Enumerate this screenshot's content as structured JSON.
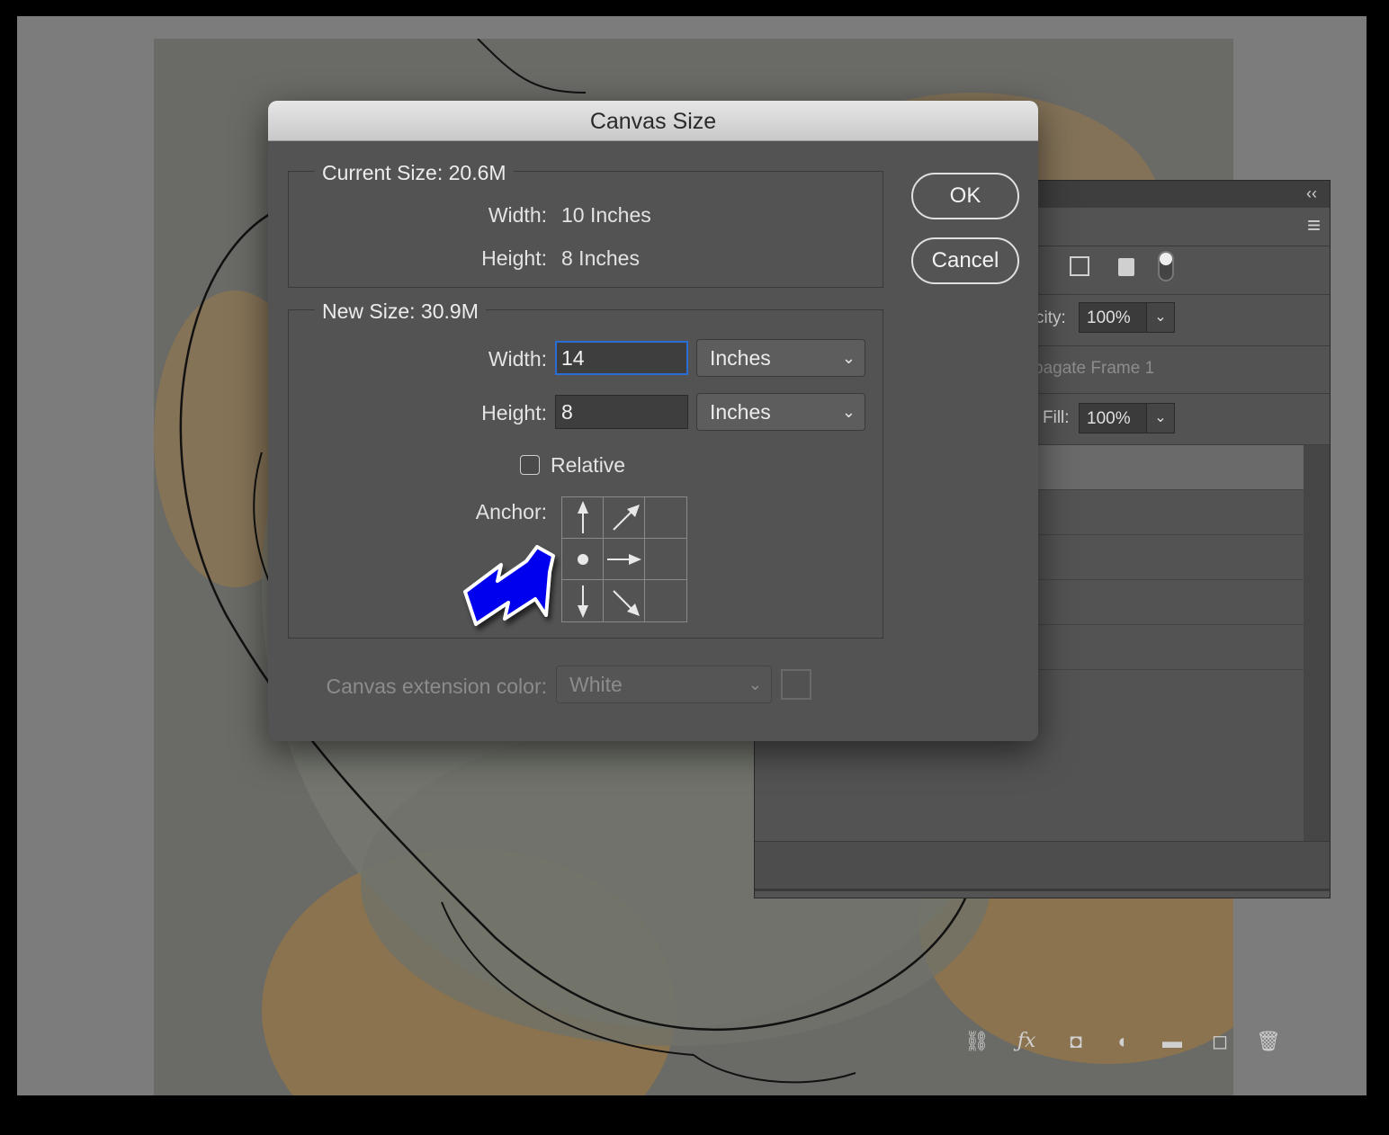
{
  "dialog": {
    "title": "Canvas Size",
    "current_size": {
      "legend": "Current Size: 20.6M",
      "width_label": "Width:",
      "width_value": "10 Inches",
      "height_label": "Height:",
      "height_value": "8 Inches"
    },
    "new_size": {
      "legend": "New Size: 30.9M",
      "width_label": "Width:",
      "width_value": "14",
      "width_unit": "Inches",
      "height_label": "Height:",
      "height_value": "8",
      "height_unit": "Inches",
      "relative_label": "Relative",
      "relative_checked": false,
      "anchor_label": "Anchor:"
    },
    "extension_color_label": "Canvas extension color:",
    "extension_color_value": "White",
    "ok_label": "OK",
    "cancel_label": "Cancel"
  },
  "layers_panel": {
    "opacity_label": "city:",
    "opacity_value": "100%",
    "propagate_label": "pagate Frame 1",
    "fill_label": "Fill:",
    "fill_value": "100%",
    "collapse_glyph": "‹‹",
    "menu_glyph": "≡"
  },
  "colors": {
    "dialog_bg": "#535353",
    "focus_ring": "#2b6dd6",
    "pointer_arrow": "#0000ee"
  }
}
